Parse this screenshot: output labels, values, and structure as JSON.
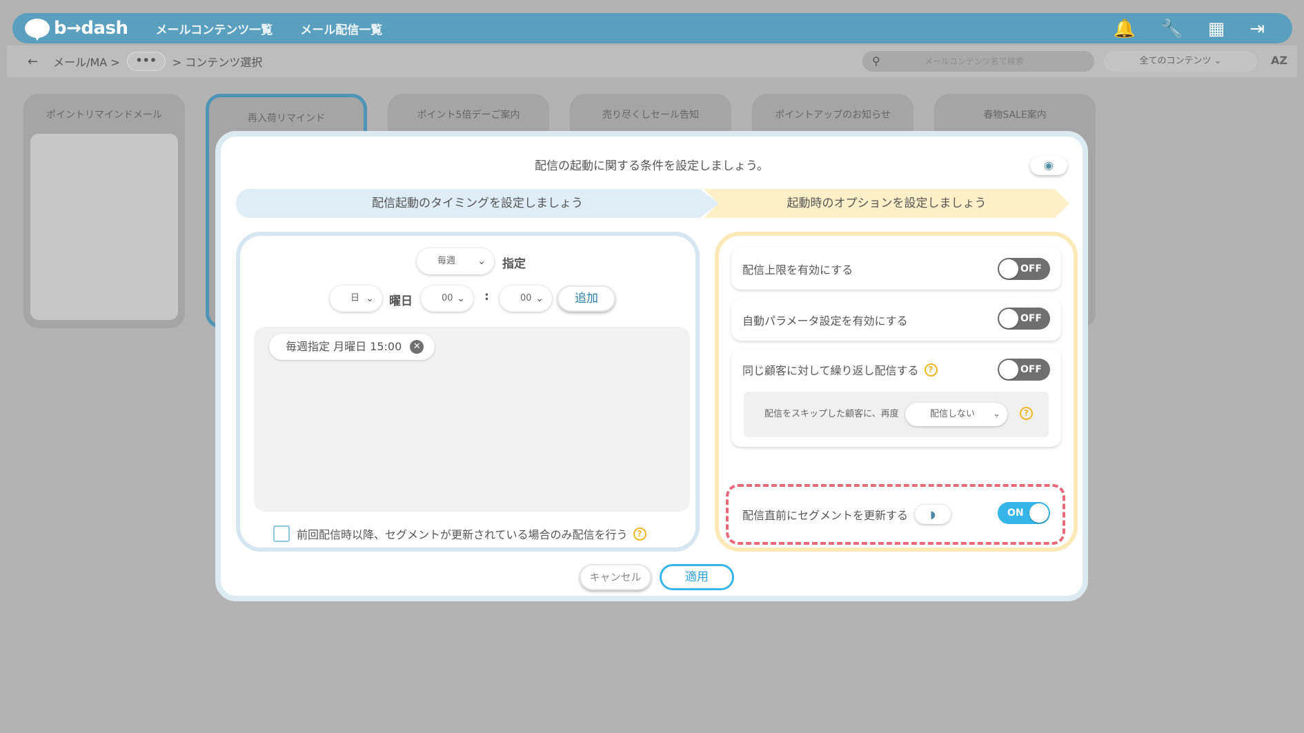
{
  "app": {
    "logo": "b→dash",
    "nav": [
      "メールコンテンツ一覧",
      "メール配信一覧"
    ],
    "breadcrumb": {
      "root": "メール/MA >",
      "ellipsis": "•••",
      "current": "> コンテンツ選択"
    },
    "search_placeholder": "メールコンテンツ名で検索",
    "filter_value": "全てのコンテンツ",
    "sort_label": "AZ",
    "cards": [
      "ポイントリマインドメール",
      "再入荷リマインド",
      "ポイント5倍デーご案内",
      "売り尽くしセール告知",
      "ポイントアップのお知らせ",
      "春物SALE案内"
    ]
  },
  "dialog": {
    "title": "配信の起動に関する条件を設定しましょう。",
    "steps": [
      "配信起動のタイミングを設定しましょう",
      "起動時のオプションを設定しましょう"
    ],
    "timing": {
      "frequency": "毎週",
      "frequency_suffix": "指定",
      "day": "日",
      "day_suffix": "曜日",
      "hour": "00",
      "minute": "00",
      "colon": ":",
      "add_label": "追加",
      "entries": [
        "毎週指定 月曜日 15:00"
      ],
      "checkbox_label": "前回配信時以降、セグメントが更新されている場合のみ配信を行う"
    },
    "options": [
      {
        "label": "配信上限を有効にする",
        "state": "OFF"
      },
      {
        "label": "自動パラメータ設定を有効にする",
        "state": "OFF"
      },
      {
        "label": "同じ顧客に対して繰り返し配信する",
        "state": "OFF",
        "sub_text": "配信をスキップした顧客に、再度",
        "sub_value": "配信しない"
      },
      {
        "label": "配信直前にセグメントを更新する",
        "state": "ON"
      }
    ],
    "cancel_label": "キャンセル",
    "apply_label": "適用"
  }
}
